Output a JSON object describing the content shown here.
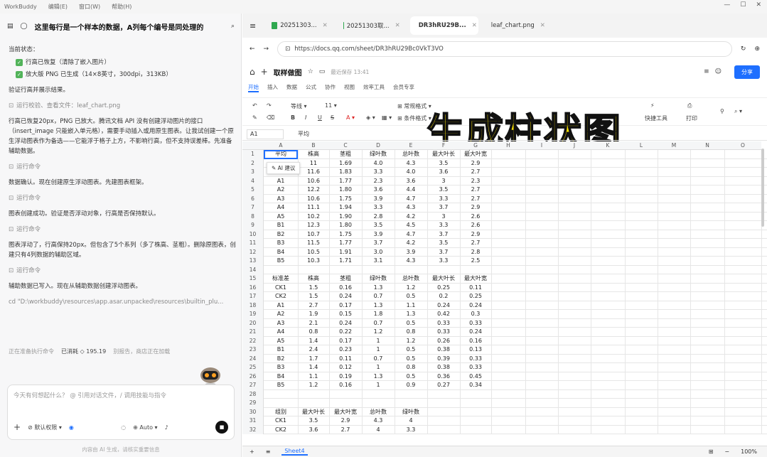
{
  "app": {
    "name": "WorkBuddy",
    "menu": [
      "编辑(E)",
      "窗口(W)",
      "帮助(H)"
    ]
  },
  "left": {
    "title": "这里每行是一个样本的数据，A列每个编号是同处理的",
    "status_label": "当前状态：",
    "checks": [
      "行高已恢复（清除了嵌入图片）",
      "放大版 PNG 已生成（14×8英寸，300dpi，313KB）"
    ],
    "msgs": [
      "验证行高并展示结果。",
      "行高已恢复20px，PNG 已放大。腾讯文档 API 没有创建浮动图片的接口（insert_image 只能嵌入单元格），需要手动插入或用原生图表。让我试创建一个原生浮动图表作为备选——它能浮于格子上方，不影响行高，但不支持误差棒。先准备辅助数据。",
      "数据确认。现在创建原生浮动图表。先建图表框架。",
      "图表创建成功。验证是否浮动对象，行高是否保持默认。",
      "图表浮动了，行高保持20px。但包含了5个系列（多了株高、茎粗）。删除原图表，创建只有4列数据的辅助区域。",
      "辅助数据已写入。现在从辅助数据创建浮动图表。"
    ],
    "steps": [
      "运行校验、查看文件：leaf_chart.png",
      "运行命令",
      "运行命令",
      "运行命令",
      "运行命令"
    ],
    "cmd": "cd \"D:\\workbuddy\\resources\\app.asar.unpacked\\resources\\builtin_plu...",
    "running": "正在准备执行命令",
    "cost": "已消耗 ◇ 195.19",
    "warn": "别报告，商店正在加载",
    "input_placeholder": "今天有何想起什么？ @ 引用对话文件，/ 调用技能与指令",
    "mode": "默认权限",
    "model": "Auto",
    "disclaimer": "内容由 AI 生成，请核实重要信息"
  },
  "browser": {
    "tabs": [
      {
        "label": "20251303...",
        "color": "#2fa84f"
      },
      {
        "label": "20251303取...",
        "color": "#2fa84f"
      },
      {
        "label": "DR3hRU29B...",
        "color": "#444444"
      },
      {
        "label": "leaf_chart.png",
        "color": "#4a90d9"
      }
    ],
    "url": "https://docs.qq.com/sheet/DR3hRU29Bc0VkT3VO"
  },
  "doc": {
    "title": "取样做图",
    "saved": "最近保存 13:41",
    "share": "分享",
    "menus": [
      "开始",
      "插入",
      "数据",
      "公式",
      "协作",
      "视图",
      "效率工具",
      "会员专享"
    ],
    "toolbar": {
      "font": "等线",
      "size": "11",
      "format1": "常规格式",
      "format2": "条件格式",
      "tool": "快捷工具",
      "print": "打印"
    }
  },
  "overlay_text": "生成柱状图",
  "formula": {
    "cell": "A1",
    "value": "平均"
  },
  "columns": [
    "A",
    "B",
    "C",
    "D",
    "E",
    "F",
    "G",
    "H",
    "I",
    "J",
    "K",
    "L",
    "M",
    "N",
    "O"
  ],
  "rows1": [
    [
      "平均",
      "株高",
      "茎粗",
      "绿叶数",
      "总叶数",
      "最大叶长",
      "最大叶宽"
    ],
    [
      "",
      "11",
      "1.69",
      "4.0",
      "4.3",
      "3.5",
      "2.9"
    ],
    [
      "",
      "11.6",
      "1.83",
      "3.3",
      "4.0",
      "3.6",
      "2.7"
    ],
    [
      "A1",
      "10.6",
      "1.77",
      "2.3",
      "3.6",
      "3",
      "2.3"
    ],
    [
      "A2",
      "12.2",
      "1.80",
      "3.6",
      "4.4",
      "3.5",
      "2.7"
    ],
    [
      "A3",
      "10.6",
      "1.75",
      "3.9",
      "4.7",
      "3.3",
      "2.7"
    ],
    [
      "A4",
      "11.1",
      "1.94",
      "3.3",
      "4.3",
      "3.7",
      "2.9"
    ],
    [
      "A5",
      "10.2",
      "1.90",
      "2.8",
      "4.2",
      "3",
      "2.6"
    ],
    [
      "B1",
      "12.3",
      "1.80",
      "3.5",
      "4.5",
      "3.3",
      "2.6"
    ],
    [
      "B2",
      "10.7",
      "1.75",
      "3.9",
      "4.7",
      "3.7",
      "2.9"
    ],
    [
      "B3",
      "11.5",
      "1.77",
      "3.7",
      "4.2",
      "3.5",
      "2.7"
    ],
    [
      "B4",
      "10.5",
      "1.91",
      "3.0",
      "3.9",
      "3.7",
      "2.8"
    ],
    [
      "B5",
      "10.3",
      "1.71",
      "3.1",
      "4.3",
      "3.3",
      "2.5"
    ]
  ],
  "rows2": [
    [
      "标准差",
      "株高",
      "茎粗",
      "绿叶数",
      "总叶数",
      "最大叶长",
      "最大叶宽"
    ],
    [
      "CK1",
      "1.5",
      "0.16",
      "1.3",
      "1.2",
      "0.25",
      "0.11"
    ],
    [
      "CK2",
      "1.5",
      "0.24",
      "0.7",
      "0.5",
      "0.2",
      "0.25"
    ],
    [
      "A1",
      "2.7",
      "0.17",
      "1.3",
      "1.1",
      "0.24",
      "0.24"
    ],
    [
      "A2",
      "1.9",
      "0.15",
      "1.8",
      "1.3",
      "0.42",
      "0.3"
    ],
    [
      "A3",
      "2.1",
      "0.24",
      "0.7",
      "0.5",
      "0.33",
      "0.33"
    ],
    [
      "A4",
      "0.8",
      "0.22",
      "1.2",
      "0.8",
      "0.33",
      "0.24"
    ],
    [
      "A5",
      "1.4",
      "0.17",
      "1",
      "1.2",
      "0.26",
      "0.16"
    ],
    [
      "B1",
      "2.4",
      "0.23",
      "1",
      "0.5",
      "0.38",
      "0.13"
    ],
    [
      "B2",
      "1.7",
      "0.11",
      "0.7",
      "0.5",
      "0.39",
      "0.33"
    ],
    [
      "B3",
      "1.4",
      "0.12",
      "1",
      "0.8",
      "0.38",
      "0.33"
    ],
    [
      "B4",
      "1.1",
      "0.19",
      "1.3",
      "0.5",
      "0.36",
      "0.45"
    ],
    [
      "B5",
      "1.2",
      "0.16",
      "1",
      "0.9",
      "0.27",
      "0.34"
    ]
  ],
  "rows3": [
    [
      "组别",
      "最大叶长",
      "最大叶宽",
      "总叶数",
      "绿叶数"
    ],
    [
      "CK1",
      "3.5",
      "2.9",
      "4.3",
      "4"
    ],
    [
      "CK2",
      "3.6",
      "2.7",
      "4",
      "3.3"
    ]
  ],
  "dropdown": "AI 建议",
  "sheet_tab": "Sheet4",
  "zoom": "100%"
}
